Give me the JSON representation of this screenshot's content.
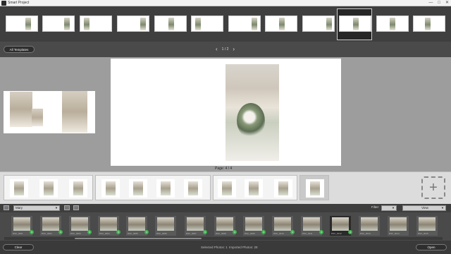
{
  "window": {
    "title": "Smart Project",
    "controls": [
      "—",
      "□",
      "✕"
    ]
  },
  "template_strip": {
    "count": 12,
    "selected_index": 9
  },
  "nav": {
    "all_templates_label": "All Templates",
    "pager": "1 / 2",
    "prev_icon": "chevron-left-icon",
    "next_icon": "chevron-right-icon"
  },
  "canvas": {
    "page_label": "Page: 4 / 4"
  },
  "pages_strip": {
    "add_icon": "plus-icon",
    "add_symbol": "+"
  },
  "tray": {
    "folder_select": "Mary",
    "filter_label": "Filter:",
    "view_select": "View",
    "photos": [
      {
        "caption": "DSC_0001",
        "badge": "1"
      },
      {
        "caption": "DSC_0002",
        "badge": "1"
      },
      {
        "caption": "DSC_0003",
        "badge": "1"
      },
      {
        "caption": "DSC_0004",
        "badge": "1"
      },
      {
        "caption": "DSC_0005",
        "badge": "1"
      },
      {
        "caption": "DSC_0006",
        "badge": ""
      },
      {
        "caption": "DSC_0007",
        "badge": "1"
      },
      {
        "caption": "DSC_0008",
        "badge": "1"
      },
      {
        "caption": "DSC_0009",
        "badge": "1"
      },
      {
        "caption": "DSC_0010",
        "badge": "1"
      },
      {
        "caption": "DSC_0011",
        "badge": "1"
      },
      {
        "caption": "DSC_0012",
        "badge": "1"
      },
      {
        "caption": "DSC_0013",
        "badge": ""
      },
      {
        "caption": "DSC_0014",
        "badge": ""
      },
      {
        "caption": "DSC_0015",
        "badge": ""
      }
    ]
  },
  "footer": {
    "clear_label": "Clear",
    "selected_photos": "Selected Photos: 1",
    "imported_photos": "Imported Photos: 28",
    "open_label": "Open"
  }
}
